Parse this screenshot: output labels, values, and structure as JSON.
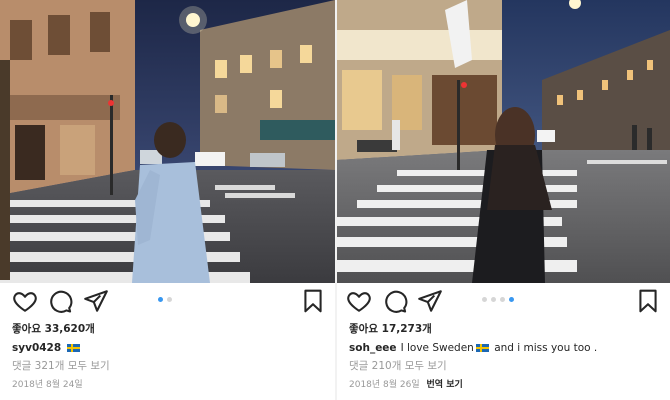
{
  "left_post": {
    "likes": "좋아요 33,620개",
    "username": "syv0428",
    "caption_text": "",
    "comments_link": "댓글 321개 모두 보기",
    "date": "2018년 8월 24일",
    "carousel": {
      "count": 2,
      "active_index": 0
    },
    "icons": [
      "heart-icon",
      "comment-icon",
      "share-icon",
      "bookmark-icon"
    ]
  },
  "right_post": {
    "likes": "좋아요 17,273개",
    "username": "soh_eee",
    "caption_before_flag": "I love Sweden",
    "caption_after_flag": "and i miss you too .",
    "comments_link": "댓글 210개 모두 보기",
    "date": "2018년 8월 26일",
    "translate_link": "번역 보기",
    "carousel": {
      "count": 4,
      "active_index": 3
    },
    "icons": [
      "heart-icon",
      "comment-icon",
      "share-icon",
      "bookmark-icon"
    ]
  },
  "colors": {
    "text": "#262626",
    "muted": "#999999",
    "carousel_active": "#3897f0",
    "carousel_inactive": "#d6d6d6",
    "sweden_blue": "#1d68b3",
    "sweden_yellow": "#f4c300"
  }
}
